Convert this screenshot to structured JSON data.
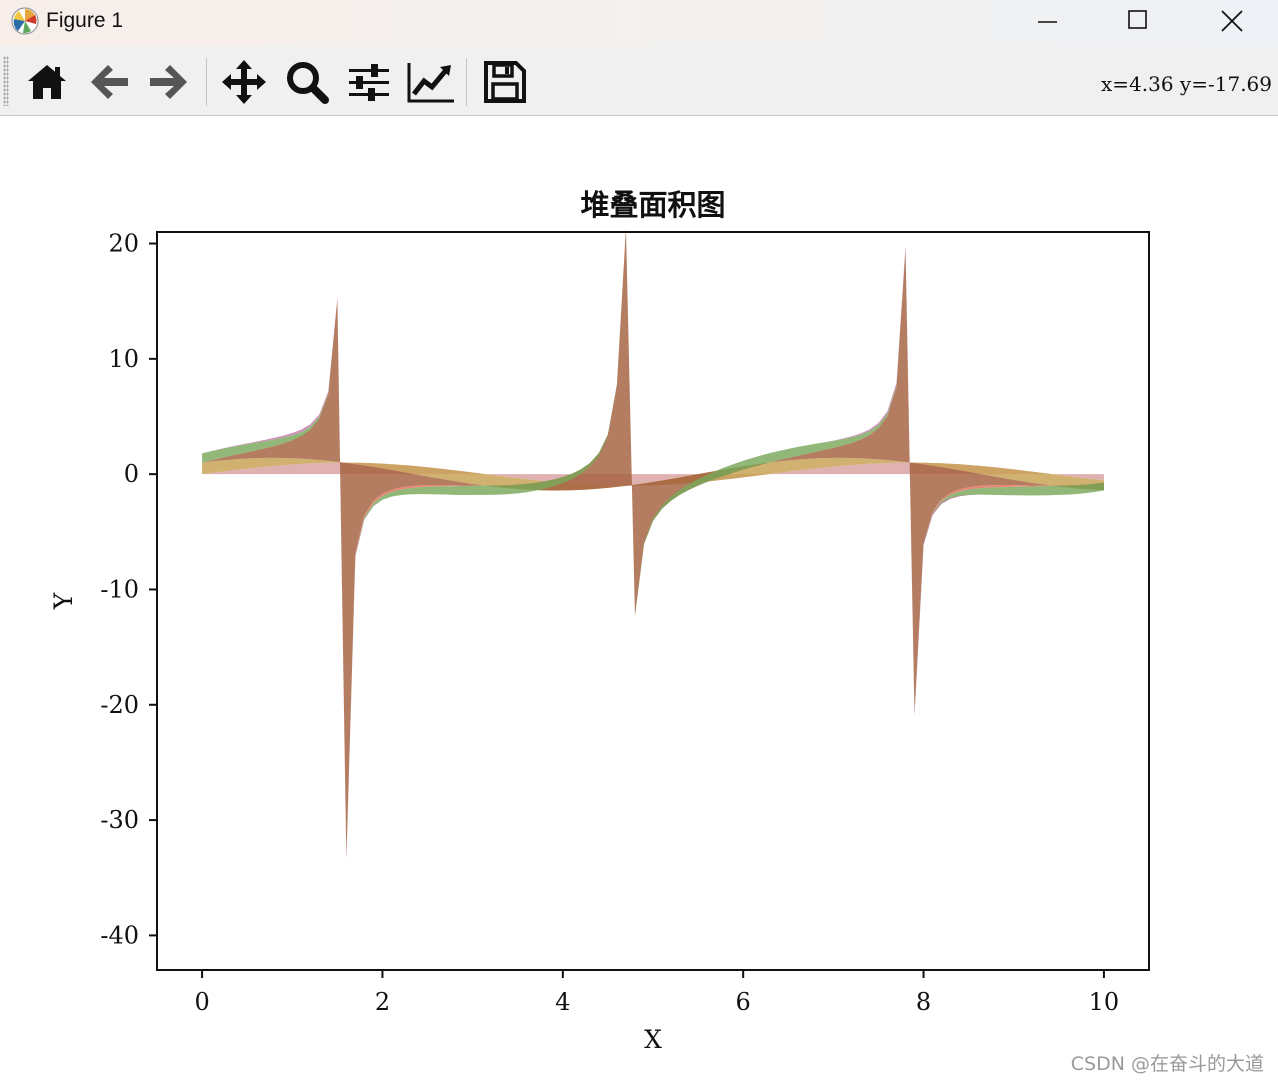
{
  "window": {
    "title": "Figure 1",
    "controls": [
      "minimize",
      "maximize",
      "close"
    ]
  },
  "toolbar": {
    "buttons": [
      {
        "name": "home",
        "icon": "home-icon"
      },
      {
        "name": "back",
        "icon": "arrow-left-icon"
      },
      {
        "name": "forward",
        "icon": "arrow-right-icon"
      },
      {
        "name": "pan",
        "icon": "move-icon"
      },
      {
        "name": "zoom",
        "icon": "search-icon"
      },
      {
        "name": "configure-subplots",
        "icon": "sliders-icon"
      },
      {
        "name": "edit-axis",
        "icon": "line-chart-icon"
      },
      {
        "name": "save",
        "icon": "floppy-disk-icon"
      }
    ],
    "coord_readout": "x=4.36  y=-17.69"
  },
  "watermark": "CSDN @在奋斗的大道",
  "chart_data": {
    "type": "area",
    "stacked": true,
    "title": "堆叠面积图",
    "xlabel": "X",
    "ylabel": "Y",
    "xlim": [
      -0.5,
      10.5
    ],
    "ylim": [
      -43,
      21
    ],
    "xticks": [
      0,
      2,
      4,
      6,
      8,
      10
    ],
    "yticks": [
      20,
      10,
      0,
      -10,
      -20,
      -30,
      -40
    ],
    "grid": false,
    "legend": "none",
    "x": [
      0.0,
      0.1,
      0.2,
      0.3,
      0.4,
      0.5,
      0.6,
      0.7,
      0.8,
      0.9,
      1.0,
      1.1,
      1.2,
      1.3,
      1.4,
      1.5,
      1.6,
      1.7,
      1.8,
      1.9,
      2.0,
      2.1,
      2.2,
      2.3,
      2.4,
      2.5,
      2.6,
      2.7,
      2.8,
      2.9,
      3.0,
      3.1,
      3.2,
      3.3,
      3.4,
      3.5,
      3.6,
      3.7,
      3.8,
      3.9,
      4.0,
      4.1,
      4.2,
      4.3,
      4.4,
      4.5,
      4.6,
      4.7,
      4.8,
      4.9,
      5.0,
      5.1,
      5.2,
      5.3,
      5.4,
      5.5,
      5.6,
      5.7,
      5.8,
      5.9,
      6.0,
      6.1,
      6.2,
      6.3,
      6.4,
      6.5,
      6.6,
      6.7,
      6.8,
      6.9,
      7.0,
      7.1,
      7.2,
      7.3,
      7.4,
      7.5,
      7.6,
      7.7,
      7.8,
      7.9,
      8.0,
      8.1,
      8.2,
      8.3,
      8.4,
      8.5,
      8.6,
      8.7,
      8.8,
      8.9,
      9.0,
      9.1,
      9.2,
      9.3,
      9.4,
      9.5,
      9.6,
      9.7,
      9.8,
      9.9,
      10.0
    ],
    "series": [
      {
        "color": "#d9a0a0",
        "values": [
          0.0,
          0.0998,
          0.1987,
          0.2955,
          0.3894,
          0.4794,
          0.5646,
          0.6442,
          0.7174,
          0.7833,
          0.8415,
          0.8912,
          0.932,
          0.9636,
          0.9854,
          0.9975,
          0.9996,
          0.9917,
          0.9738,
          0.9463,
          0.9093,
          0.8632,
          0.8085,
          0.7457,
          0.6755,
          0.5985,
          0.5155,
          0.4274,
          0.335,
          0.2392,
          0.1411,
          0.0416,
          -0.0584,
          -0.1577,
          -0.2555,
          -0.3508,
          -0.4425,
          -0.5298,
          -0.6119,
          -0.6878,
          -0.7568,
          -0.8183,
          -0.8716,
          -0.9162,
          -0.9516,
          -0.9775,
          -0.9937,
          -0.9999,
          -0.9962,
          -0.9825,
          -0.9589,
          -0.9258,
          -0.8835,
          -0.8323,
          -0.7728,
          -0.7055,
          -0.6313,
          -0.5507,
          -0.4646,
          -0.3739,
          -0.2794,
          -0.1822,
          -0.0831,
          0.0168,
          0.1165,
          0.2151,
          0.3115,
          0.4048,
          0.4941,
          0.5784,
          0.657,
          0.729,
          0.7937,
          0.8504,
          0.8987,
          0.938,
          0.9679,
          0.9882,
          0.9985,
          0.9989,
          0.9894,
          0.9699,
          0.9407,
          0.9022,
          0.8546,
          0.7985,
          0.7344,
          0.663,
          0.585,
          0.501,
          0.4121,
          0.319,
          0.2229,
          0.1245,
          0.0248,
          -0.0752,
          -0.1743,
          -0.2718,
          -0.3665,
          -0.4575,
          -0.544
        ]
      },
      {
        "color": "#c7a050",
        "values": [
          1.0,
          0.995,
          0.9801,
          0.9553,
          0.9211,
          0.8776,
          0.8253,
          0.7648,
          0.6967,
          0.6216,
          0.5403,
          0.4536,
          0.3624,
          0.2675,
          0.17,
          0.0707,
          -0.0292,
          -0.1288,
          -0.2272,
          -0.3233,
          -0.4161,
          -0.5048,
          -0.5885,
          -0.6663,
          -0.7374,
          -0.8011,
          -0.8569,
          -0.904,
          -0.9422,
          -0.971,
          -0.99,
          -0.9991,
          -0.9983,
          -0.9875,
          -0.9668,
          -0.9365,
          -0.8968,
          -0.8481,
          -0.791,
          -0.7259,
          -0.6536,
          -0.5748,
          -0.4903,
          -0.4008,
          -0.3073,
          -0.2108,
          -0.1122,
          -0.0124,
          0.0875,
          0.1865,
          0.2837,
          0.378,
          0.4685,
          0.5544,
          0.6347,
          0.7087,
          0.7756,
          0.8347,
          0.8855,
          0.9275,
          0.9602,
          0.9833,
          0.9965,
          0.9999,
          0.9932,
          0.9766,
          0.9502,
          0.9144,
          0.8694,
          0.8157,
          0.7539,
          0.6845,
          0.6084,
          0.5261,
          0.4385,
          0.3466,
          0.2513,
          0.1534,
          0.054,
          -0.046,
          -0.1455,
          -0.2435,
          -0.3392,
          -0.4314,
          -0.5193,
          -0.602,
          -0.6787,
          -0.7486,
          -0.8111,
          -0.8654,
          -0.9111,
          -0.9477,
          -0.9748,
          -0.9922,
          -0.9997,
          -0.9972,
          -0.9847,
          -0.9624,
          -0.9304,
          -0.8892,
          -0.8391
        ]
      },
      {
        "color": "#a3603e",
        "values": [
          0.0,
          0.1003,
          0.2027,
          0.3093,
          0.4228,
          0.5463,
          0.6841,
          0.8423,
          1.0296,
          1.2602,
          1.5574,
          1.9648,
          2.5722,
          3.6021,
          5.7979,
          14.1014,
          -34.2325,
          -7.6966,
          -4.2863,
          -2.9271,
          -2.185,
          -1.71,
          -1.3738,
          -1.1192,
          -0.916,
          -0.747,
          -0.6016,
          -0.4727,
          -0.3555,
          -0.2464,
          -0.1425,
          -0.0416,
          0.0585,
          0.1597,
          0.2643,
          0.3746,
          0.4935,
          0.6247,
          0.7736,
          0.9474,
          1.1578,
          1.4235,
          1.7777,
          2.2858,
          3.0963,
          4.6373,
          8.8602,
          80.7128,
          -11.385,
          -5.2675,
          -3.3805,
          -2.4494,
          -1.8856,
          -1.5013,
          -1.2175,
          -0.9956,
          -0.8139,
          -0.6597,
          -0.5247,
          -0.4031,
          -0.291,
          -0.1853,
          -0.0834,
          0.0168,
          0.1173,
          0.2203,
          0.3279,
          0.4427,
          0.5683,
          0.7091,
          0.8714,
          1.065,
          1.3046,
          1.6164,
          2.0494,
          2.706,
          3.8512,
          6.4405,
          18.4955,
          -21.7432,
          -6.7997,
          -3.9838,
          -2.7735,
          -2.0914,
          -1.6458,
          -1.3264,
          -1.0821,
          -0.8857,
          -0.7213,
          -0.5789,
          -0.4523,
          -0.3366,
          -0.2287,
          -0.1255,
          -0.0248,
          0.0754,
          0.177,
          0.2824,
          0.3939,
          0.5145,
          0.6484
        ]
      },
      {
        "color": "#e06e5a",
        "values": [
          0.0,
          0.0,
          0.0,
          0.0,
          0.0,
          0.0,
          0.0,
          0.0,
          0.0,
          0.0,
          0.0,
          -0.03,
          -0.06,
          -0.08,
          -0.1,
          -0.12,
          -0.14,
          -0.16,
          -0.18,
          -0.2,
          -0.2,
          -0.2,
          -0.19,
          -0.18,
          -0.16,
          -0.14,
          -0.12,
          -0.1,
          -0.08,
          -0.05,
          -0.02,
          0.0,
          0.0,
          0.0,
          0.0,
          0.0,
          0.0,
          0.0,
          0.0,
          0.0,
          0.0,
          0.0,
          0.0,
          0.0,
          0.0,
          0.0,
          0.0,
          0.0,
          0.0,
          0.0,
          0.0,
          0.0,
          0.0,
          0.0,
          0.0,
          0.0,
          0.0,
          0.0,
          0.0,
          0.0,
          0.0,
          0.0,
          0.0,
          0.0,
          0.0,
          0.0,
          0.0,
          0.0,
          0.0,
          0.0,
          0.0,
          0.0,
          0.0,
          0.0,
          0.0,
          0.0,
          0.0,
          0.0,
          0.0,
          -0.03,
          -0.06,
          -0.09,
          -0.12,
          -0.15,
          -0.18,
          -0.2,
          -0.21,
          -0.21,
          -0.2,
          -0.18,
          -0.15,
          -0.12,
          -0.09,
          -0.06,
          -0.03,
          0.0,
          0.0,
          0.0,
          0.0,
          0.0,
          0.0
        ]
      },
      {
        "color": "#79a85a",
        "values": [
          0.8,
          0.79,
          0.78,
          0.76,
          0.73,
          0.7,
          0.66,
          0.61,
          0.56,
          0.5,
          0.43,
          0.36,
          0.29,
          0.21,
          0.14,
          0.06,
          -0.02,
          -0.1,
          -0.18,
          -0.26,
          -0.33,
          -0.4,
          -0.47,
          -0.53,
          -0.59,
          -0.64,
          -0.69,
          -0.72,
          -0.75,
          -0.78,
          -0.79,
          -0.8,
          -0.8,
          -0.79,
          -0.77,
          -0.75,
          -0.72,
          -0.68,
          -0.63,
          -0.58,
          -0.52,
          -0.46,
          -0.39,
          -0.32,
          -0.25,
          -0.17,
          -0.09,
          -0.01,
          0.07,
          0.15,
          0.23,
          0.3,
          0.37,
          0.44,
          0.51,
          0.57,
          0.62,
          0.67,
          0.71,
          0.74,
          0.77,
          0.79,
          0.8,
          0.8,
          0.79,
          0.78,
          0.76,
          0.73,
          0.7,
          0.65,
          0.6,
          0.55,
          0.49,
          0.42,
          0.35,
          0.28,
          0.2,
          0.12,
          0.04,
          -0.04,
          -0.12,
          -0.19,
          -0.27,
          -0.35,
          -0.42,
          -0.48,
          -0.54,
          -0.6,
          -0.65,
          -0.69,
          -0.73,
          -0.76,
          -0.78,
          -0.79,
          -0.8,
          -0.8,
          -0.79,
          -0.77,
          -0.74,
          -0.71,
          -0.67
        ]
      },
      {
        "color": "#c27aa8",
        "values": [
          0.0,
          0.01,
          0.02,
          0.03,
          0.05,
          0.07,
          0.09,
          0.12,
          0.15,
          0.18,
          0.2,
          0.22,
          0.23,
          0.22,
          0.2,
          0.17,
          0.14,
          0.1,
          0.06,
          0.03,
          0.0,
          0.0,
          0.0,
          0.0,
          0.0,
          0.0,
          0.0,
          0.0,
          0.0,
          0.0,
          0.0,
          0.0,
          0.0,
          0.0,
          0.0,
          0.0,
          0.0,
          0.0,
          0.0,
          0.0,
          0.0,
          0.0,
          0.0,
          0.0,
          0.0,
          0.0,
          0.0,
          0.0,
          0.0,
          0.0,
          0.0,
          0.0,
          0.0,
          0.0,
          0.0,
          0.0,
          0.0,
          0.0,
          0.0,
          0.0,
          0.0,
          0.0,
          0.0,
          0.0,
          0.0,
          0.0,
          0.0,
          0.0,
          0.0,
          0.01,
          0.03,
          0.05,
          0.08,
          0.11,
          0.14,
          0.17,
          0.2,
          0.22,
          0.23,
          0.22,
          0.2,
          0.17,
          0.13,
          0.09,
          0.05,
          0.02,
          0.0,
          0.0,
          0.0,
          0.0,
          0.0,
          0.0,
          0.0,
          0.0,
          0.0,
          0.0,
          0.0,
          0.0,
          0.0,
          0.0,
          0.0
        ]
      }
    ]
  }
}
